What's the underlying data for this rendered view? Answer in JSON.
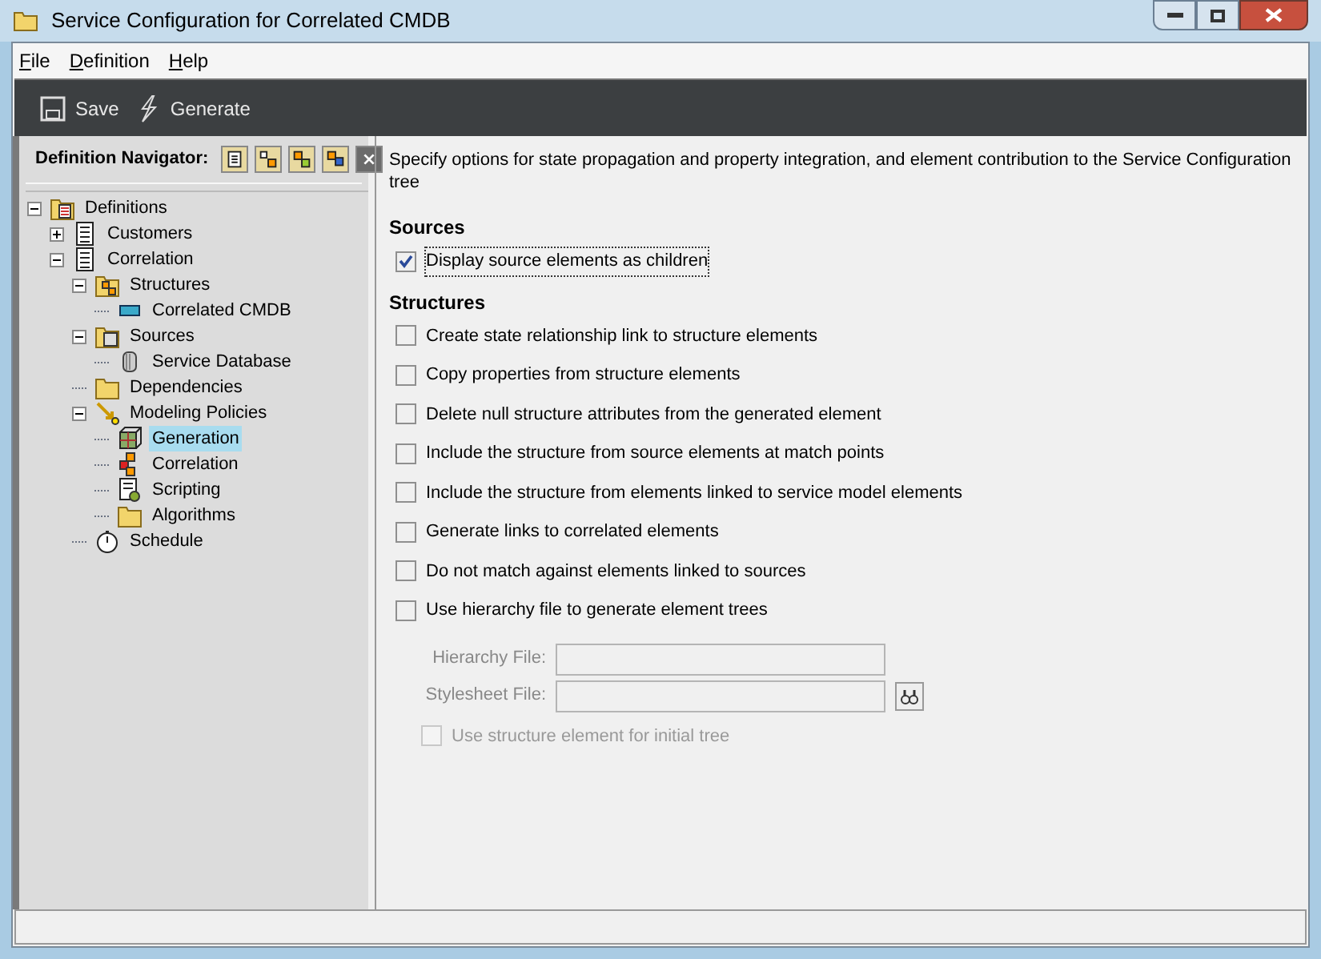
{
  "window": {
    "title": "Service Configuration for Correlated CMDB"
  },
  "menu": [
    {
      "label": "File"
    },
    {
      "label": "Definition"
    },
    {
      "label": "Help"
    }
  ],
  "toolbar": [
    {
      "kind": "save",
      "label": "Save"
    },
    {
      "kind": "generate",
      "label": "Generate"
    }
  ],
  "navigator": {
    "title": "Definition Navigator:",
    "tools": [
      {
        "kind": "new"
      },
      {
        "kind": "add"
      },
      {
        "kind": "link"
      },
      {
        "kind": "move"
      },
      {
        "kind": "close"
      }
    ],
    "tree": [
      {
        "label": "Definitions",
        "kind": "defs",
        "expanded": true,
        "selected": false,
        "children": [
          {
            "label": "Customers",
            "kind": "list",
            "expanded": false,
            "selected": false
          },
          {
            "label": "Correlation",
            "kind": "list",
            "expanded": true,
            "selected": false,
            "children": [
              {
                "label": "Structures",
                "kind": "structures",
                "expanded": true,
                "selected": false,
                "children": [
                  {
                    "label": "Correlated CMDB",
                    "kind": "bar",
                    "selected": false
                  }
                ]
              },
              {
                "label": "Sources",
                "kind": "sources",
                "expanded": true,
                "selected": false,
                "children": [
                  {
                    "label": "Service Database",
                    "kind": "db",
                    "selected": false
                  }
                ]
              },
              {
                "label": "Dependencies",
                "kind": "folder",
                "selected": false
              },
              {
                "label": "Modeling Policies",
                "kind": "policy",
                "expanded": true,
                "selected": false,
                "children": [
                  {
                    "label": "Generation",
                    "kind": "cube",
                    "selected": true
                  },
                  {
                    "label": "Correlation",
                    "kind": "blocks",
                    "selected": false
                  },
                  {
                    "label": "Scripting",
                    "kind": "script",
                    "selected": false
                  },
                  {
                    "label": "Algorithms",
                    "kind": "folder",
                    "selected": false
                  }
                ]
              },
              {
                "label": "Schedule",
                "kind": "clock",
                "selected": false
              }
            ]
          }
        ]
      }
    ]
  },
  "content": {
    "description": "Specify options for state propagation and property integration, and element contribution to the Service Configuration tree",
    "sections": [
      {
        "title": "Sources",
        "options": [
          {
            "label": "Display source elements as children",
            "checked": true,
            "disabled": false,
            "focused": true
          }
        ]
      },
      {
        "title": "Structures",
        "options": [
          {
            "label": "Create state relationship link to structure elements",
            "checked": false,
            "disabled": false,
            "focused": false
          },
          {
            "label": "Copy properties from structure elements",
            "checked": false,
            "disabled": false,
            "focused": false
          },
          {
            "label": "Delete null structure attributes from the generated element",
            "checked": false,
            "disabled": false,
            "focused": false
          },
          {
            "label": "Include the structure from source elements at match points",
            "checked": false,
            "disabled": false,
            "focused": false
          },
          {
            "label": "Include the structure from elements linked to service model elements",
            "checked": false,
            "disabled": false,
            "focused": false
          },
          {
            "label": "Generate links to correlated elements",
            "checked": false,
            "disabled": false,
            "focused": false
          },
          {
            "label": "Do not match against elements linked to sources",
            "checked": false,
            "disabled": false,
            "focused": false
          },
          {
            "label": "Use hierarchy file to generate element trees",
            "checked": false,
            "disabled": false,
            "focused": false
          }
        ]
      }
    ],
    "fields": [
      {
        "label": "Hierarchy File:",
        "disabled": true,
        "browse": false
      },
      {
        "label": "Stylesheet File:",
        "disabled": true,
        "browse": true
      }
    ],
    "sub_option": {
      "label": "Use structure element for initial tree",
      "checked": false,
      "disabled": true
    }
  }
}
